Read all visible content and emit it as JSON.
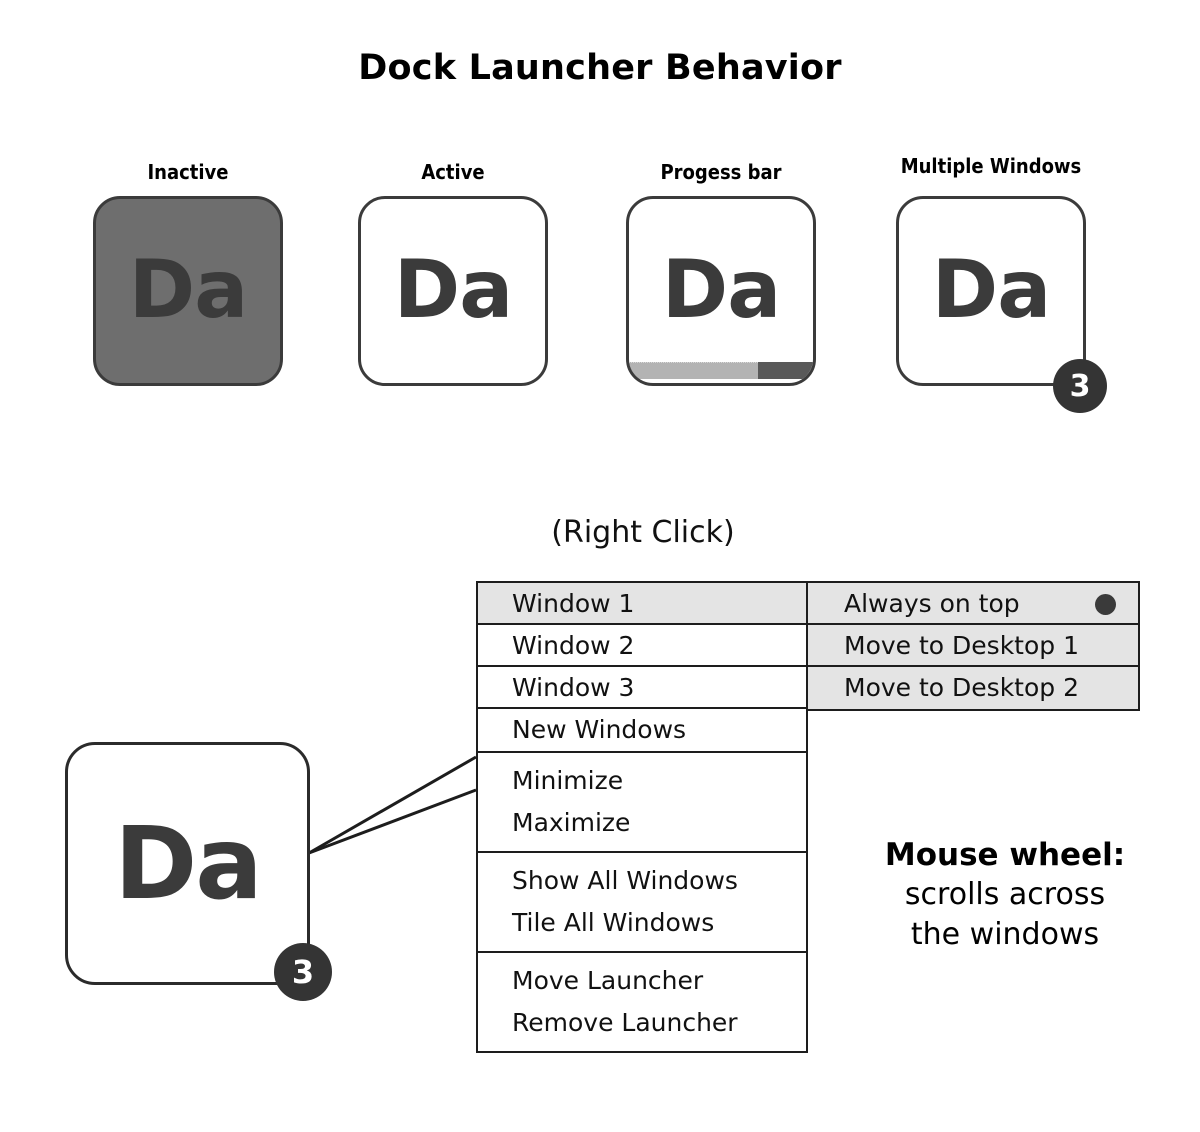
{
  "page": {
    "title": "Dock Launcher Behavior",
    "background_color": "#ffffff"
  },
  "colors": {
    "icon_border": "#3b3b3b",
    "icon_glyph": "#3b3b3b",
    "inactive_fill": "#6e6e6e",
    "badge_fill": "#343434",
    "badge_text": "#ffffff",
    "menu_border": "#1d1d1d",
    "menu_highlight": "#e4e4e4",
    "progress_filled": "#b3b3b3",
    "progress_remaining": "#595959",
    "radio_dot": "#3a3a3a"
  },
  "states": [
    {
      "label": "Inactive",
      "glyph": "Da",
      "fill": "inactive",
      "has_progress": false,
      "badge": null
    },
    {
      "label": "Active",
      "glyph": "Da",
      "fill": "white",
      "has_progress": false,
      "badge": null
    },
    {
      "label": "Progess bar",
      "glyph": "Da",
      "fill": "white",
      "has_progress": true,
      "progress_percent": 70,
      "badge": null
    },
    {
      "label": "Multiple Windows",
      "glyph": "Da",
      "fill": "white",
      "has_progress": false,
      "badge": "3"
    }
  ],
  "right_click": {
    "caption": "(Right Click)",
    "launcher": {
      "glyph": "Da",
      "badge": "3"
    },
    "menu_groups": [
      {
        "items": [
          {
            "label": "Window 1",
            "highlight": true,
            "separator": true
          },
          {
            "label": "Window 2",
            "highlight": false,
            "separator": true
          },
          {
            "label": "Window 3",
            "highlight": false,
            "separator": true
          },
          {
            "label": "New Windows",
            "highlight": false,
            "separator": false
          }
        ]
      },
      {
        "items": [
          {
            "label": "Minimize",
            "highlight": false,
            "separator": false
          },
          {
            "label": "Maximize",
            "highlight": false,
            "separator": false
          }
        ]
      },
      {
        "items": [
          {
            "label": "Show All Windows",
            "highlight": false,
            "separator": false
          },
          {
            "label": "Tile All Windows",
            "highlight": false,
            "separator": false
          }
        ]
      },
      {
        "items": [
          {
            "label": "Move Launcher",
            "highlight": false,
            "separator": false
          },
          {
            "label": "Remove Launcher",
            "highlight": false,
            "separator": false
          }
        ]
      }
    ],
    "submenu": {
      "items": [
        {
          "label": "Always on top",
          "separator": true,
          "indicator": "radio-dot"
        },
        {
          "label": "Move to Desktop 1",
          "separator": true,
          "indicator": null
        },
        {
          "label": "Move to Desktop 2",
          "separator": true,
          "indicator": null
        }
      ]
    }
  },
  "mouse_wheel_note": {
    "title": "Mouse wheel:",
    "line1": "scrolls across",
    "line2": "the windows"
  }
}
